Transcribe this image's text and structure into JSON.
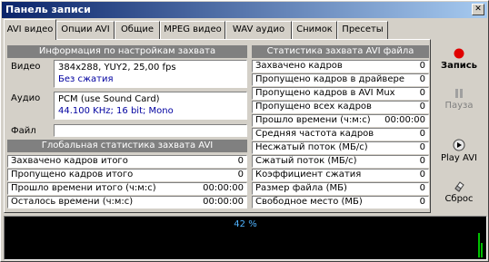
{
  "window": {
    "title": "Панель записи",
    "close_label": "✕"
  },
  "tabs": [
    {
      "label": "AVI видео",
      "active": true
    },
    {
      "label": "Опции AVI",
      "active": false
    },
    {
      "label": "Общие",
      "active": false
    },
    {
      "label": "MPEG видео",
      "active": false
    },
    {
      "label": "WAV аудио",
      "active": false
    },
    {
      "label": "Снимок",
      "active": false
    },
    {
      "label": "Пресеты",
      "active": false
    }
  ],
  "capture_info": {
    "header": "Информация по настройкам захвата",
    "video_label": "Видео",
    "video_format": "384x288, YUY2, 25,00 fps",
    "video_compression": "Без сжатия",
    "audio_label": "Аудио",
    "audio_source": "PCM (use Sound Card)",
    "audio_format": "44.100 KHz; 16 bit; Mono",
    "file_label": "Файл",
    "file_value": ""
  },
  "global_stats": {
    "header": "Глобальная статистика захвата AVI",
    "rows": [
      {
        "label": "Захвачено кадров итого",
        "value": "0"
      },
      {
        "label": "Пропущено кадров итого",
        "value": "0"
      },
      {
        "label": "Прошло времени итого (ч:м:с)",
        "value": "00:00:00"
      },
      {
        "label": "Осталось времени (ч:м:с)",
        "value": "00:00:00"
      }
    ]
  },
  "avi_stats": {
    "header": "Статистика захвата AVI файла",
    "rows": [
      {
        "label": "Захвачено кадров",
        "value": "0"
      },
      {
        "label": "Пропущено кадров в драйвере",
        "value": "0"
      },
      {
        "label": "Пропущено кадров в AVI Mux",
        "value": "0"
      },
      {
        "label": "Пропущено всех кадров",
        "value": "0"
      },
      {
        "label": "Прошло времени (ч:м:с)",
        "value": "00:00:00"
      },
      {
        "label": "Средняя частота кадров",
        "value": "0"
      },
      {
        "label": "Несжатый поток (МБ/с)",
        "value": "0"
      },
      {
        "label": "Сжатый поток (МБ/с)",
        "value": "0"
      },
      {
        "label": "Коэффициент сжатия",
        "value": "0"
      },
      {
        "label": "Размер файла (МБ)",
        "value": "0"
      },
      {
        "label": "Свободное место (МБ)",
        "value": "0"
      }
    ]
  },
  "buttons": {
    "record": "Запись",
    "pause": "Пауза",
    "play": "Play AVI",
    "reset": "Сброс"
  },
  "progress": {
    "text": "42 %",
    "value": 42
  },
  "colors": {
    "record": "#e00000",
    "title_start": "#0a246a",
    "title_end": "#a6caf0",
    "level": "#00c000",
    "percent_text": "#4fb3ff"
  }
}
